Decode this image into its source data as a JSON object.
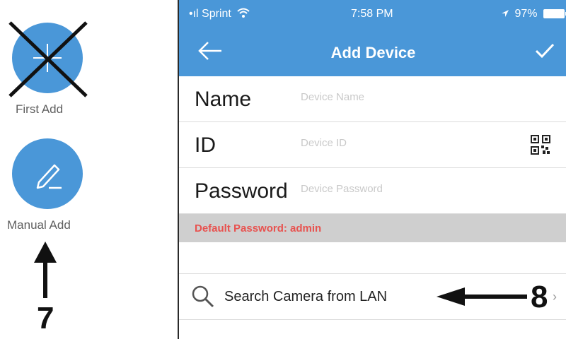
{
  "left_panel": {
    "first_add_label": "First Add",
    "manual_add_label": "Manual Add",
    "step_seven": "7"
  },
  "status_bar": {
    "carrier": "Sprint",
    "time": "7:58 PM",
    "battery": "97%"
  },
  "nav": {
    "title": "Add Device"
  },
  "form": {
    "name_label": "Name",
    "name_placeholder": "Device Name",
    "id_label": "ID",
    "id_placeholder": "Device ID",
    "password_label": "Password",
    "password_placeholder": "Device Password"
  },
  "notice": {
    "default_password": "Default Password: admin"
  },
  "search": {
    "label": "Search Camera from LAN",
    "step_eight": "8",
    "chevron": "›"
  },
  "colors": {
    "brand_blue": "#4a97d8",
    "notice_red": "#e8524f",
    "notice_bg": "#cfcfcf"
  },
  "icons": [
    "plus-icon",
    "cross-out-mark",
    "pencil-icon",
    "up-arrow",
    "wifi-icon",
    "location-icon",
    "battery-icon",
    "back-arrow-icon",
    "checkmark-icon",
    "qr-code-icon",
    "search-icon",
    "left-arrow",
    "chevron-right-icon"
  ]
}
